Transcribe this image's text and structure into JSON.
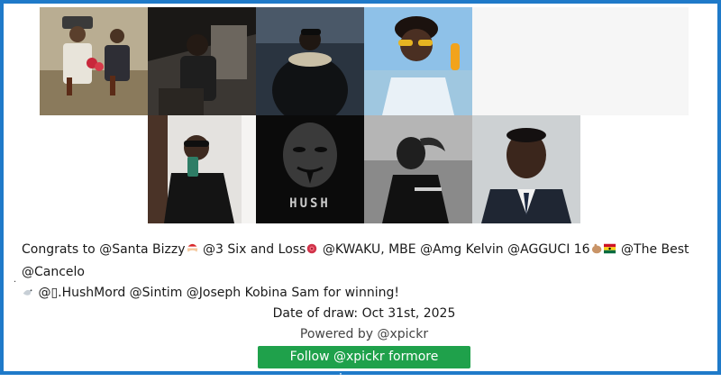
{
  "gallery": {
    "row1": [
      {
        "name": "photo-elderly-man-and-boy",
        "alt": ""
      },
      {
        "name": "photo-man-in-car-doorway",
        "alt": ""
      },
      {
        "name": "photo-man-in-hooded-jacket",
        "alt": ""
      },
      {
        "name": "photo-young-man-sunglasses",
        "alt": ""
      }
    ],
    "row2": [
      {
        "name": "photo-mirror-selfie",
        "alt": ""
      },
      {
        "name": "photo-hush-mask",
        "alt": "",
        "overlay_text": "HUSH"
      },
      {
        "name": "photo-profile-bw",
        "alt": ""
      },
      {
        "name": "photo-man-in-suit",
        "alt": ""
      }
    ]
  },
  "winners": {
    "lead": "Congrats to",
    "entries": [
      {
        "handle": "@Santa Bizzy",
        "emoji": "santa-face"
      },
      {
        "handle": "@3 Six and Loss",
        "emoji": "red-flower"
      },
      {
        "handle": "@KWAKU, MBE",
        "emoji": ""
      },
      {
        "handle": "@Amg Kelvin",
        "emoji": ""
      },
      {
        "handle": "@AGGUCI 16",
        "emoji": "hand-and-ghana-flag"
      },
      {
        "handle": "@The Best",
        "emoji": ""
      },
      {
        "handle": "@Cancelo",
        "emoji": "dove"
      },
      {
        "handle": "@▯.HushMord",
        "emoji": ""
      },
      {
        "handle": "@Sintim",
        "emoji": ""
      },
      {
        "handle": "@Joseph Kobina Sam",
        "emoji": ""
      }
    ],
    "tail": "for winning!",
    "stray_mark": "."
  },
  "draw_date": "Date of draw: Oct 31st, 2025",
  "powered_by": "Powered by @xpickr",
  "follow_button": "Follow @xpickr formore giveaways",
  "colors": {
    "border": "#1f7ac9",
    "follow_button_bg": "#1fa14b",
    "follow_button_text": "#ffffff"
  }
}
